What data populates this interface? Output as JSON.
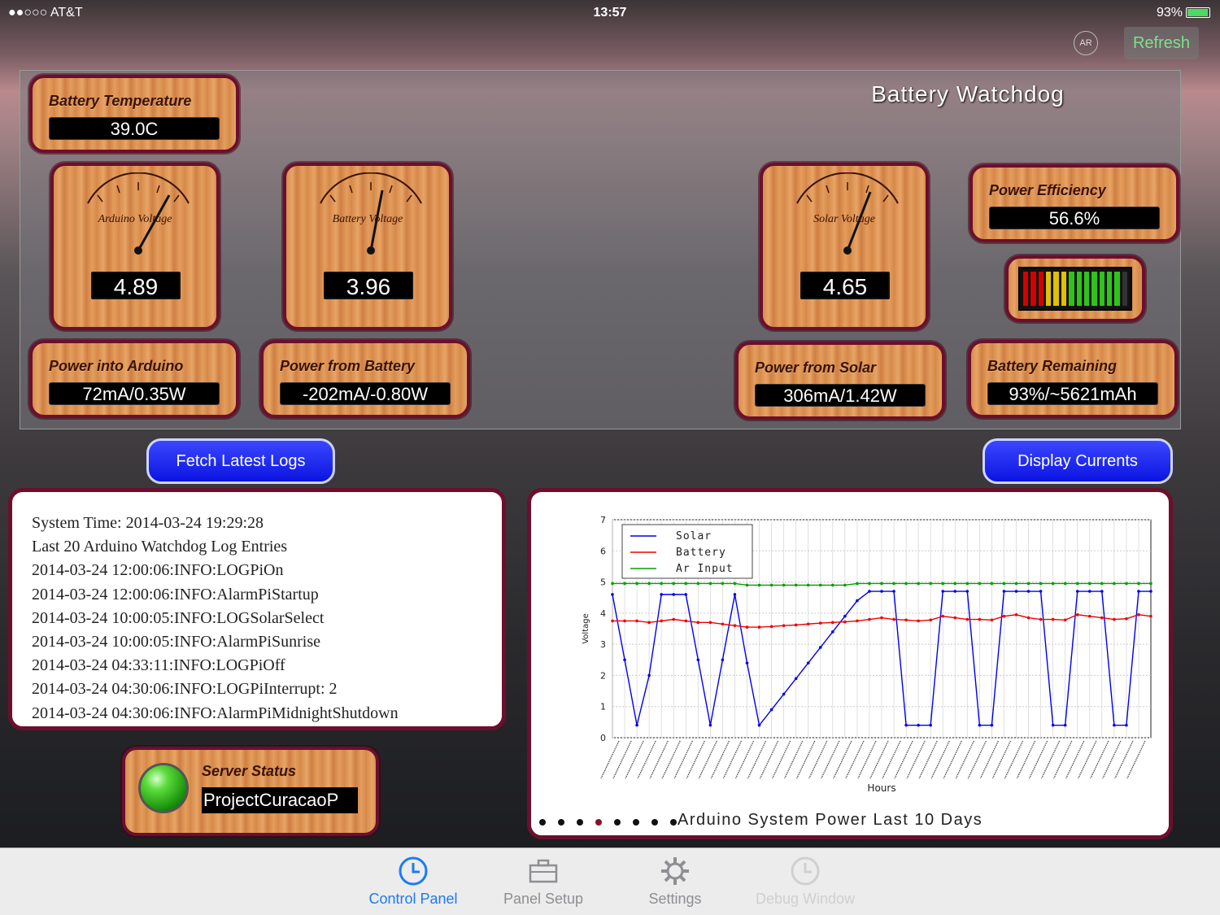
{
  "statusbar": {
    "carrier": "●●○○○ AT&T ︎ ",
    "time": "13:57",
    "battery": "93%"
  },
  "header": {
    "ar_label": "AR",
    "refresh_label": "Refresh",
    "title": "Battery Watchdog"
  },
  "tiles": {
    "battery_temperature": {
      "label": "Battery Temperature",
      "value": "39.0C"
    },
    "power_efficiency": {
      "label": "Power Efficiency",
      "value": "56.6%"
    },
    "power_into_arduino": {
      "label": "Power into Arduino",
      "value": "72mA/0.35W"
    },
    "power_from_battery": {
      "label": "Power from Battery",
      "value": "-202mA/-0.80W"
    },
    "power_from_solar": {
      "label": "Power from Solar",
      "value": "306mA/1.42W"
    },
    "battery_remaining": {
      "label": "Battery Remaining",
      "value": "93%/~5621mAh"
    }
  },
  "gauges": {
    "arduino": {
      "label": "Arduino Voltage",
      "value": "4.89"
    },
    "battery": {
      "label": "Battery Voltage",
      "value": "3.96"
    },
    "solar": {
      "label": "Solar Voltage",
      "value": "4.65"
    }
  },
  "level_bar": {
    "value": 0.93,
    "colors": [
      "#d40000",
      "#e0c000",
      "#2fc41a"
    ]
  },
  "buttons": {
    "fetch_logs": "Fetch Latest Logs",
    "display_currents": "Display Currents"
  },
  "log": {
    "lines": [
      "System Time: 2014-03-24 19:29:28",
      "Last 20 Arduino Watchdog Log Entries",
      "2014-03-24 12:00:06:INFO:LOGPiOn",
      "2014-03-24 12:00:06:INFO:AlarmPiStartup",
      "2014-03-24 10:00:05:INFO:LOGSolarSelect",
      "2014-03-24 10:00:05:INFO:AlarmPiSunrise",
      "2014-03-24 04:33:11:INFO:LOGPiOff",
      "2014-03-24 04:30:06:INFO:LOGPiInterrupt: 2",
      "2014-03-24 04:30:06:INFO:AlarmPiMidnightShutdown"
    ]
  },
  "server": {
    "label": "Server Status",
    "value": "ProjectCuracaoP"
  },
  "chart_caption": "Arduino System Power Last 10 Days",
  "page_dots": {
    "count": 8,
    "active": 3
  },
  "chart_data": {
    "type": "line",
    "title": "",
    "xlabel": "Hours",
    "ylabel": "Voltage",
    "ylim": [
      0,
      7
    ],
    "yticks": [
      0,
      1,
      2,
      3,
      4,
      5,
      6,
      7
    ],
    "grid": true,
    "legend": "top-left",
    "x": [
      0,
      1,
      2,
      3,
      4,
      5,
      6,
      7,
      8,
      9,
      10,
      11,
      12,
      13,
      14,
      15,
      16,
      17,
      18,
      19,
      20,
      21,
      22,
      23,
      24,
      25,
      26,
      27,
      28,
      29,
      30,
      31,
      32,
      33,
      34,
      35,
      36,
      37,
      38,
      39,
      40,
      41,
      42,
      43,
      44
    ],
    "series": [
      {
        "name": "Solar",
        "color": "#0000ee",
        "values": [
          4.6,
          2.5,
          0.4,
          2.0,
          4.6,
          4.6,
          4.6,
          2.5,
          0.4,
          2.5,
          4.6,
          2.4,
          0.4,
          0.9,
          1.4,
          1.9,
          2.4,
          2.9,
          3.4,
          3.9,
          4.4,
          4.7,
          4.7,
          4.7,
          0.4,
          0.4,
          0.4,
          4.7,
          4.7,
          4.7,
          0.4,
          0.4,
          4.7,
          4.7,
          4.7,
          4.7,
          0.4,
          0.4,
          4.7,
          4.7,
          4.7,
          0.4,
          0.4,
          4.7,
          4.7
        ]
      },
      {
        "name": "Battery",
        "color": "#ee0000",
        "values": [
          3.75,
          3.75,
          3.75,
          3.7,
          3.75,
          3.8,
          3.75,
          3.7,
          3.7,
          3.65,
          3.6,
          3.55,
          3.55,
          3.57,
          3.6,
          3.62,
          3.65,
          3.68,
          3.7,
          3.72,
          3.75,
          3.8,
          3.85,
          3.8,
          3.78,
          3.75,
          3.78,
          3.9,
          3.85,
          3.8,
          3.8,
          3.78,
          3.9,
          3.95,
          3.85,
          3.8,
          3.8,
          3.78,
          3.95,
          3.9,
          3.85,
          3.8,
          3.82,
          3.95,
          3.9
        ]
      },
      {
        "name": "Ar Input",
        "color": "#00a000",
        "values": [
          4.95,
          4.95,
          4.95,
          4.95,
          4.95,
          4.95,
          4.95,
          4.95,
          4.95,
          4.95,
          4.95,
          4.9,
          4.9,
          4.9,
          4.9,
          4.9,
          4.9,
          4.9,
          4.9,
          4.9,
          4.95,
          4.95,
          4.95,
          4.95,
          4.95,
          4.95,
          4.95,
          4.95,
          4.95,
          4.95,
          4.95,
          4.95,
          4.95,
          4.95,
          4.95,
          4.95,
          4.95,
          4.95,
          4.95,
          4.95,
          4.95,
          4.95,
          4.95,
          4.95,
          4.95
        ]
      }
    ]
  },
  "tabs": [
    {
      "label": "Control Panel",
      "icon": "clock-icon",
      "active": true
    },
    {
      "label": "Panel Setup",
      "icon": "toolbox-icon",
      "active": false
    },
    {
      "label": "Settings",
      "icon": "gear-icon",
      "active": false
    },
    {
      "label": "Debug Window",
      "icon": "clock-icon",
      "active": false,
      "disabled": true
    }
  ]
}
